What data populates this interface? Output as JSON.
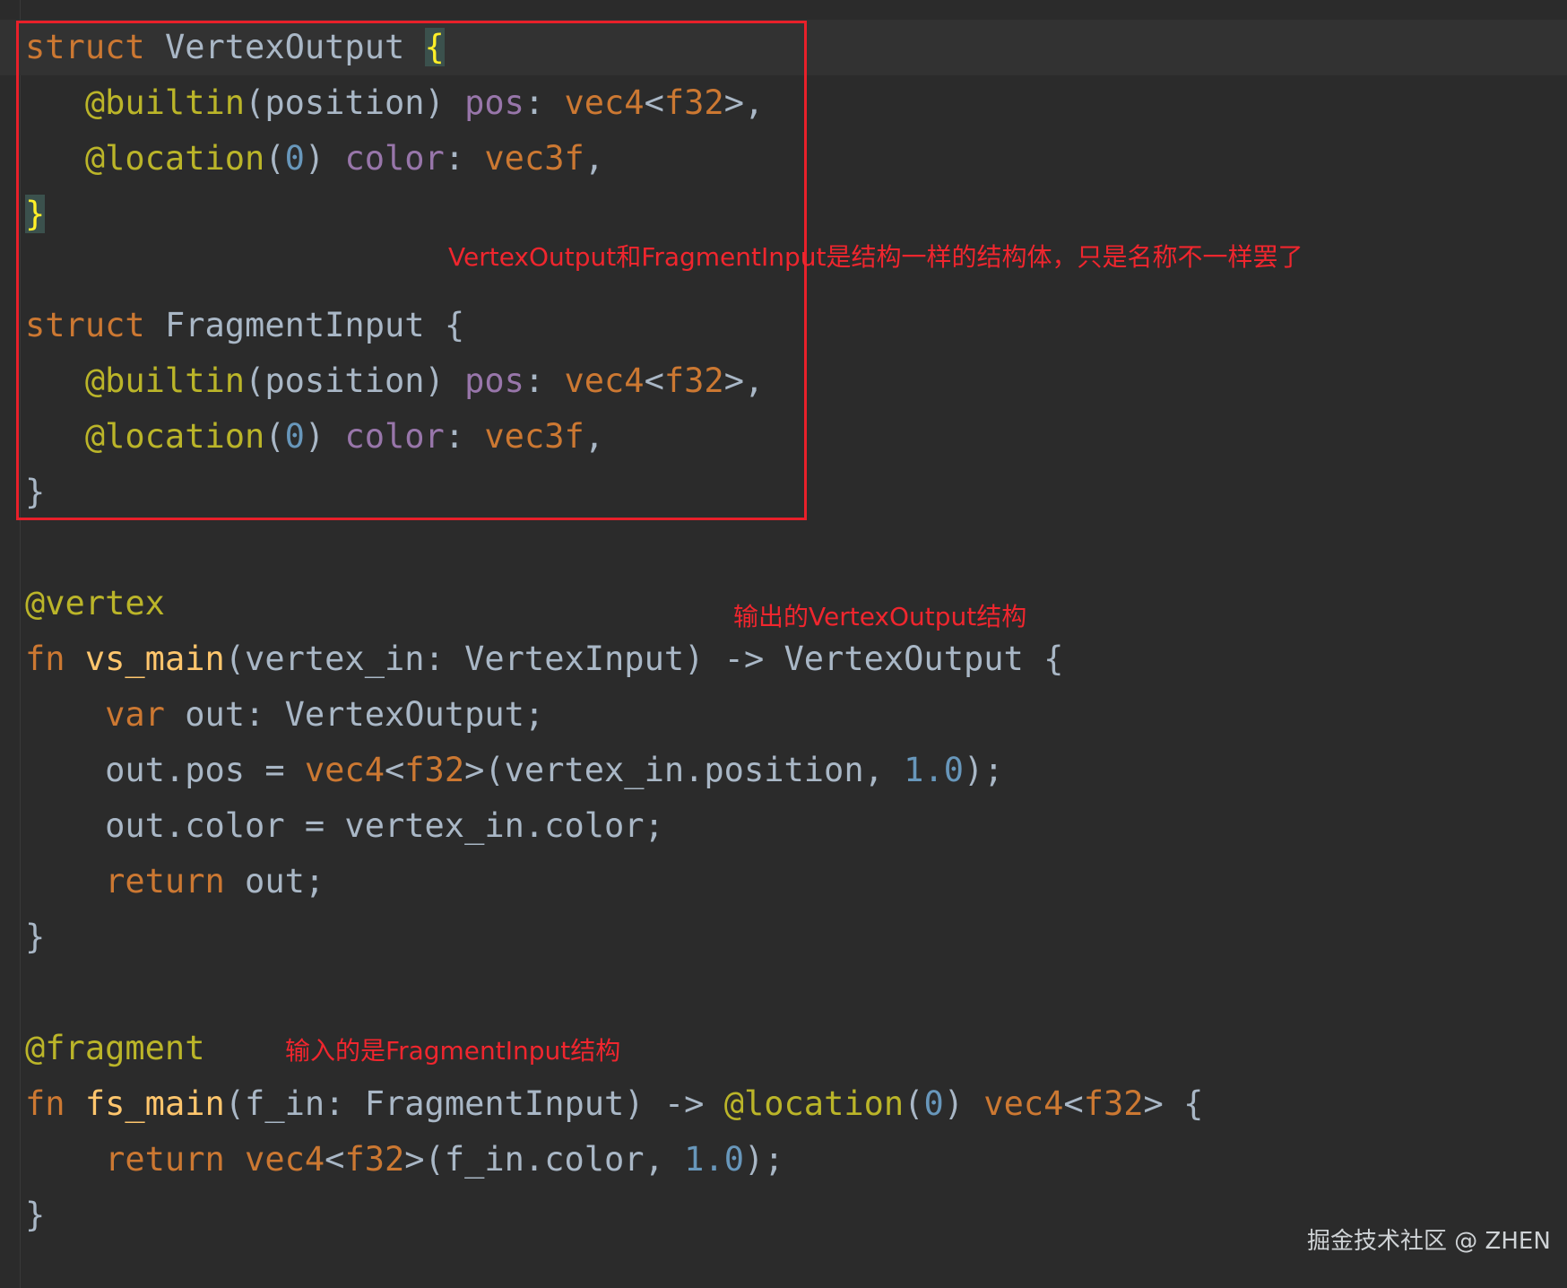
{
  "code": {
    "l1": [
      "struct",
      "VertexOutput",
      "{"
    ],
    "l2": [
      "@builtin",
      "(position)",
      "pos",
      ":",
      "vec4",
      "<",
      "f32",
      ">,"
    ],
    "l3": [
      "@location",
      "(",
      "0",
      ")",
      "color",
      ":",
      "vec3f",
      ","
    ],
    "l4": [
      "}"
    ],
    "l6": [
      "struct",
      "FragmentInput",
      "{"
    ],
    "l7": [
      "@builtin",
      "(position)",
      "pos",
      ":",
      "vec4",
      "<",
      "f32",
      ">,"
    ],
    "l8": [
      "@location",
      "(",
      "0",
      ")",
      "color",
      ":",
      "vec3f",
      ","
    ],
    "l9": [
      "}"
    ],
    "l11": [
      "@vertex"
    ],
    "l12": [
      "fn",
      "vs_main",
      "(vertex_in: VertexInput) -> VertexOutput {"
    ],
    "l13": [
      "var",
      "out: VertexOutput;"
    ],
    "l14": [
      "out.pos = ",
      "vec4",
      "<",
      "f32",
      ">(vertex_in.position, ",
      "1.0",
      ");"
    ],
    "l15": [
      "out.color = vertex_in.color;"
    ],
    "l16": [
      "return",
      "out;"
    ],
    "l17": [
      "}"
    ],
    "l19": [
      "@fragment"
    ],
    "l20": [
      "fn",
      "fs_main",
      "(f_in: FragmentInput) -> ",
      "@location",
      "(",
      "0",
      ") ",
      "vec4",
      "<",
      "f32",
      "> {"
    ],
    "l21": [
      "return",
      "vec4",
      "<",
      "f32",
      ">(f_in.color, ",
      "1.0",
      ");"
    ],
    "l22": [
      "}"
    ]
  },
  "annotations": {
    "struct_note": "VertexOutput和FragmentInput是结构一样的结构体，只是名称不一样罢了",
    "vertex_note": "输出的VertexOutput结构",
    "fragment_note": "输入的是FragmentInput结构"
  },
  "watermark": "掘金技术社区 @ ZHEN",
  "colors": {
    "background": "#2b2b2b",
    "keyword": "#cc7832",
    "type_name": "#ffc66d",
    "annotation": "#bbb529",
    "field": "#9876aa",
    "number": "#6897bb",
    "plain": "#a9b7c6",
    "note_red": "#f0262e",
    "box_red": "#e8202a"
  }
}
